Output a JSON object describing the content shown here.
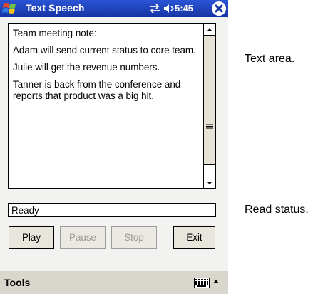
{
  "titlebar": {
    "title": "Text Speech",
    "time": "5:45"
  },
  "textarea": {
    "paragraphs": [
      "Team meeting note:",
      "Adam will send current status to core team.",
      "Julie will get the revenue numbers.",
      "Tanner is back from the conference and reports that product was a big hit."
    ]
  },
  "status": {
    "value": "Ready"
  },
  "buttons": {
    "play": "Play",
    "pause": "Pause",
    "stop": "Stop",
    "exit": "Exit"
  },
  "menubar": {
    "tools": "Tools"
  },
  "callouts": {
    "text_area": "Text area.",
    "read_status": "Read status."
  },
  "colors": {
    "titlebar": "#1a3fb0",
    "body": "#f2f2f0",
    "menubar": "#d9d7cd"
  },
  "icons": [
    "windows-start-icon",
    "connectivity-icon",
    "volume-icon",
    "close-icon",
    "keyboard-icon",
    "sip-arrow-icon"
  ]
}
